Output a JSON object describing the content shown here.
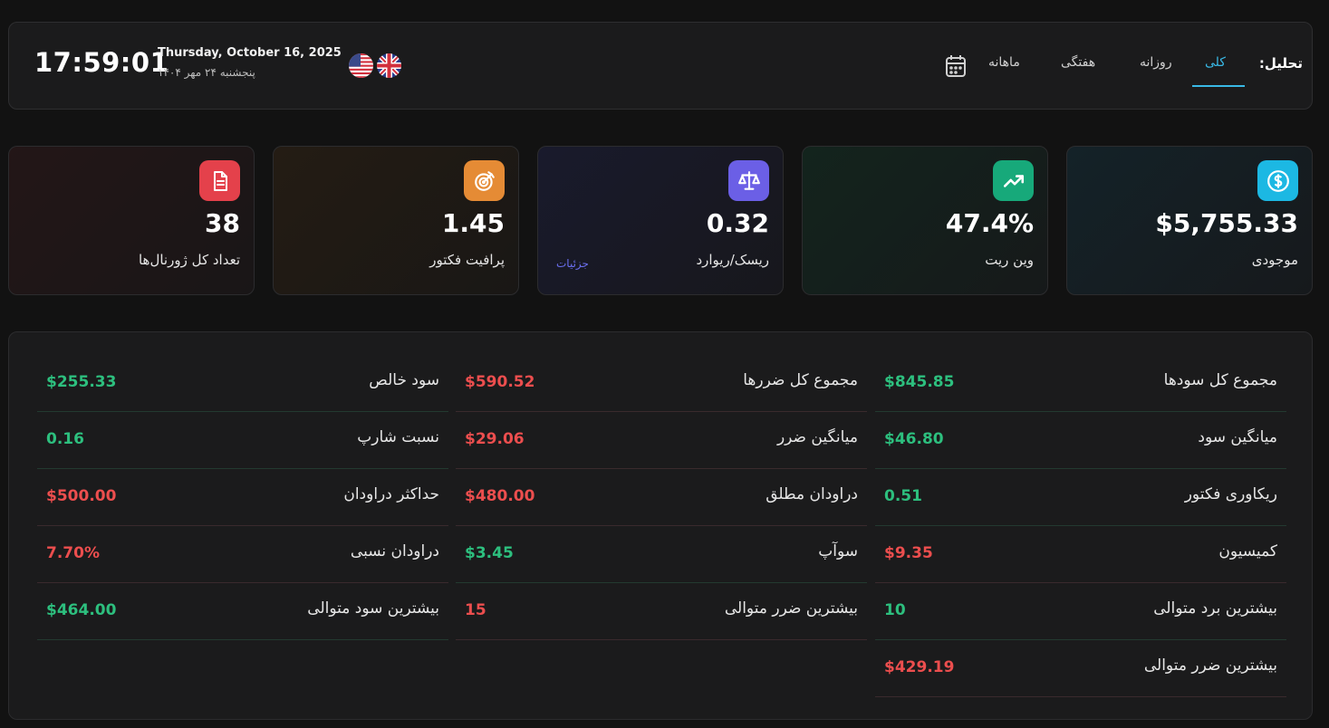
{
  "header": {
    "clock": "17:59:01",
    "date_en": "Thursday, October 16, 2025",
    "date_fa": "پنجشنبه ۲۴ مهر ۱۴۰۴",
    "analysis_label": "تحلیل:",
    "tabs": [
      {
        "label": "کلی",
        "active": true
      },
      {
        "label": "روزانه",
        "active": false
      },
      {
        "label": "هفتگی",
        "active": false
      },
      {
        "label": "ماهانه",
        "active": false
      }
    ],
    "icons": [
      "us-flag-icon",
      "uk-flag-icon",
      "calendar-icon"
    ]
  },
  "cards": [
    {
      "value": "$5,755.33",
      "label": "موجودی",
      "icon": "dollar-icon",
      "color": "#1cb8e3"
    },
    {
      "value": "47.4%",
      "label": "وین ریت",
      "icon": "trending-up-icon",
      "color": "#17a97a"
    },
    {
      "value": "0.32",
      "label": "ریسک/ریوارد",
      "icon": "scale-icon",
      "color": "#6b5fe6",
      "details": "جزئیات"
    },
    {
      "value": "1.45",
      "label": "پرافیت فکتور",
      "icon": "target-icon",
      "color": "#e58b35"
    },
    {
      "value": "38",
      "label": "تعداد کل ژورنال‌ها",
      "icon": "document-icon",
      "color": "#e4414b"
    }
  ],
  "stats": {
    "col_right": [
      {
        "label": "مجموع کل سودها",
        "value": "$845.85",
        "tone": "pos"
      },
      {
        "label": "میانگین سود",
        "value": "$46.80",
        "tone": "pos"
      },
      {
        "label": "ریکاوری فکتور",
        "value": "0.51",
        "tone": "pos"
      },
      {
        "label": "کمیسیون",
        "value": "$9.35",
        "tone": "neg"
      },
      {
        "label": "بیشترین برد متوالی",
        "value": "10",
        "tone": "pos"
      },
      {
        "label": "بیشترین ضرر متوالی",
        "value": "$429.19",
        "tone": "neg"
      }
    ],
    "col_middle": [
      {
        "label": "مجموع کل ضررها",
        "value": "$590.52",
        "tone": "neg"
      },
      {
        "label": "میانگین ضرر",
        "value": "$29.06",
        "tone": "neg"
      },
      {
        "label": "دراودان مطلق",
        "value": "$480.00",
        "tone": "neg"
      },
      {
        "label": "سوآپ",
        "value": "$3.45",
        "tone": "pos"
      },
      {
        "label": "بیشترین ضرر متوالی",
        "value": "15",
        "tone": "neg"
      }
    ],
    "col_left": [
      {
        "label": "سود خالص",
        "value": "$255.33",
        "tone": "pos"
      },
      {
        "label": "نسبت شارپ",
        "value": "0.16",
        "tone": "pos"
      },
      {
        "label": "حداکثر دراودان",
        "value": "$500.00",
        "tone": "neg"
      },
      {
        "label": "دراودان نسبی",
        "value": "7.70%",
        "tone": "neg"
      },
      {
        "label": "بیشترین سود متوالی",
        "value": "$464.00",
        "tone": "pos"
      }
    ]
  }
}
